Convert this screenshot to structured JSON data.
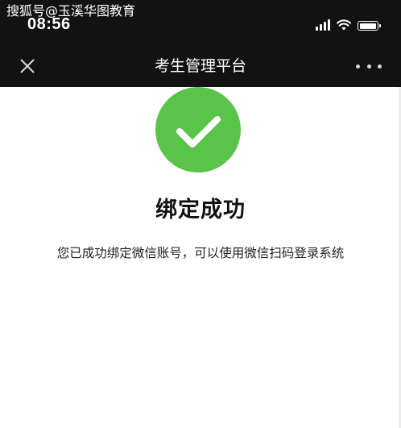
{
  "watermark": "搜狐号@玉溪华图教育",
  "status_bar": {
    "time": "08:56",
    "icons": [
      "cellular-signal-icon",
      "wifi-icon",
      "battery-icon"
    ]
  },
  "navbar": {
    "close_icon": "close-icon",
    "title": "考生管理平台",
    "more_icon": "more-icon"
  },
  "result": {
    "icon": "check-circle-icon",
    "title": "绑定成功",
    "description": "您已成功绑定微信账号，可以使用微信扫码登录系统"
  },
  "colors": {
    "top_bar": "#121212",
    "success_green": "#5ac34a",
    "background": "#ffffff"
  }
}
